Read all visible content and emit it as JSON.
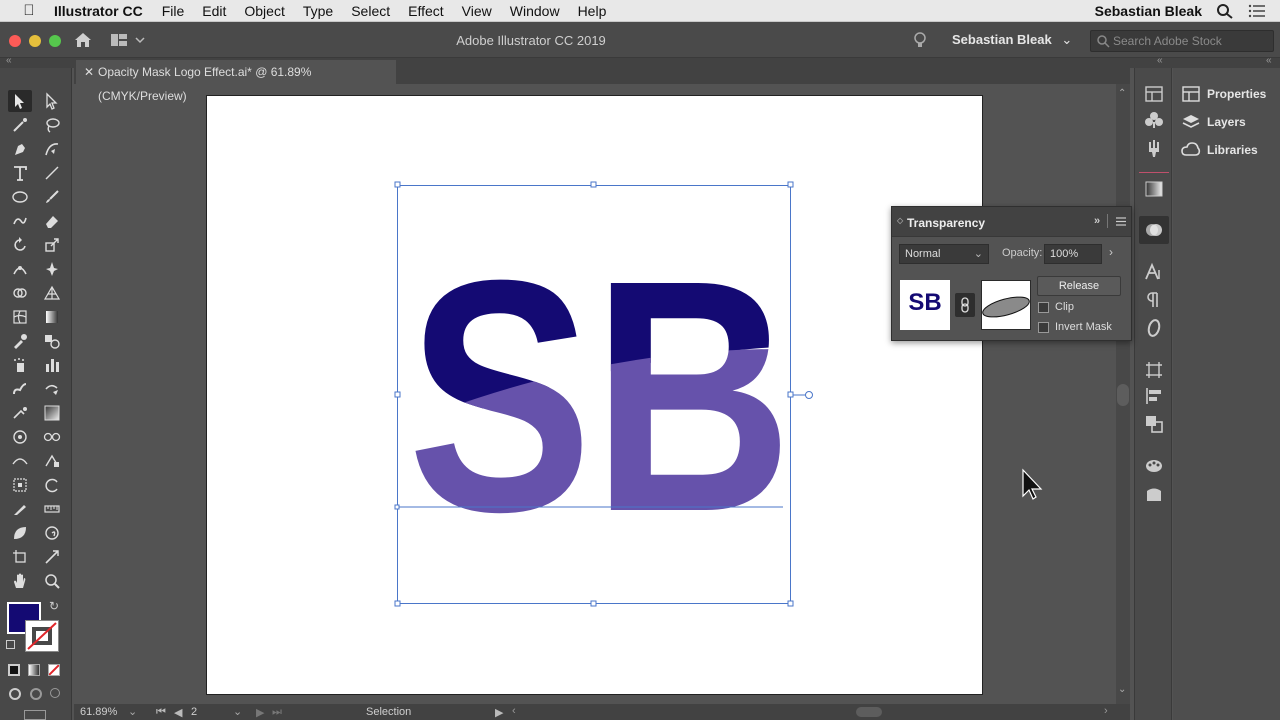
{
  "menubar": {
    "app_name": "Illustrator CC",
    "items": [
      "File",
      "Edit",
      "Object",
      "Type",
      "Select",
      "Effect",
      "View",
      "Window",
      "Help"
    ],
    "user": "Sebastian Bleak"
  },
  "appbar": {
    "title": "Adobe Illustrator CC 2019",
    "user": "Sebastian Bleak",
    "search_placeholder": "Search Adobe Stock"
  },
  "document": {
    "tab_title": "Opacity Mask Logo Effect.ai* @ 61.89% (CMYK/Preview)",
    "logo_text": "SB",
    "colors": {
      "dark": "#140a73",
      "light": "#6652ab"
    }
  },
  "right_panel": {
    "items": [
      "Properties",
      "Layers",
      "Libraries"
    ]
  },
  "transparency": {
    "title": "Transparency",
    "blend_mode": "Normal",
    "opacity_label": "Opacity:",
    "opacity_value": "100%",
    "thumb_text": "SB",
    "release_label": "Release",
    "clip_label": "Clip",
    "invert_label": "Invert Mask"
  },
  "status": {
    "zoom": "61.89%",
    "artboard": "2",
    "tool": "Selection"
  }
}
